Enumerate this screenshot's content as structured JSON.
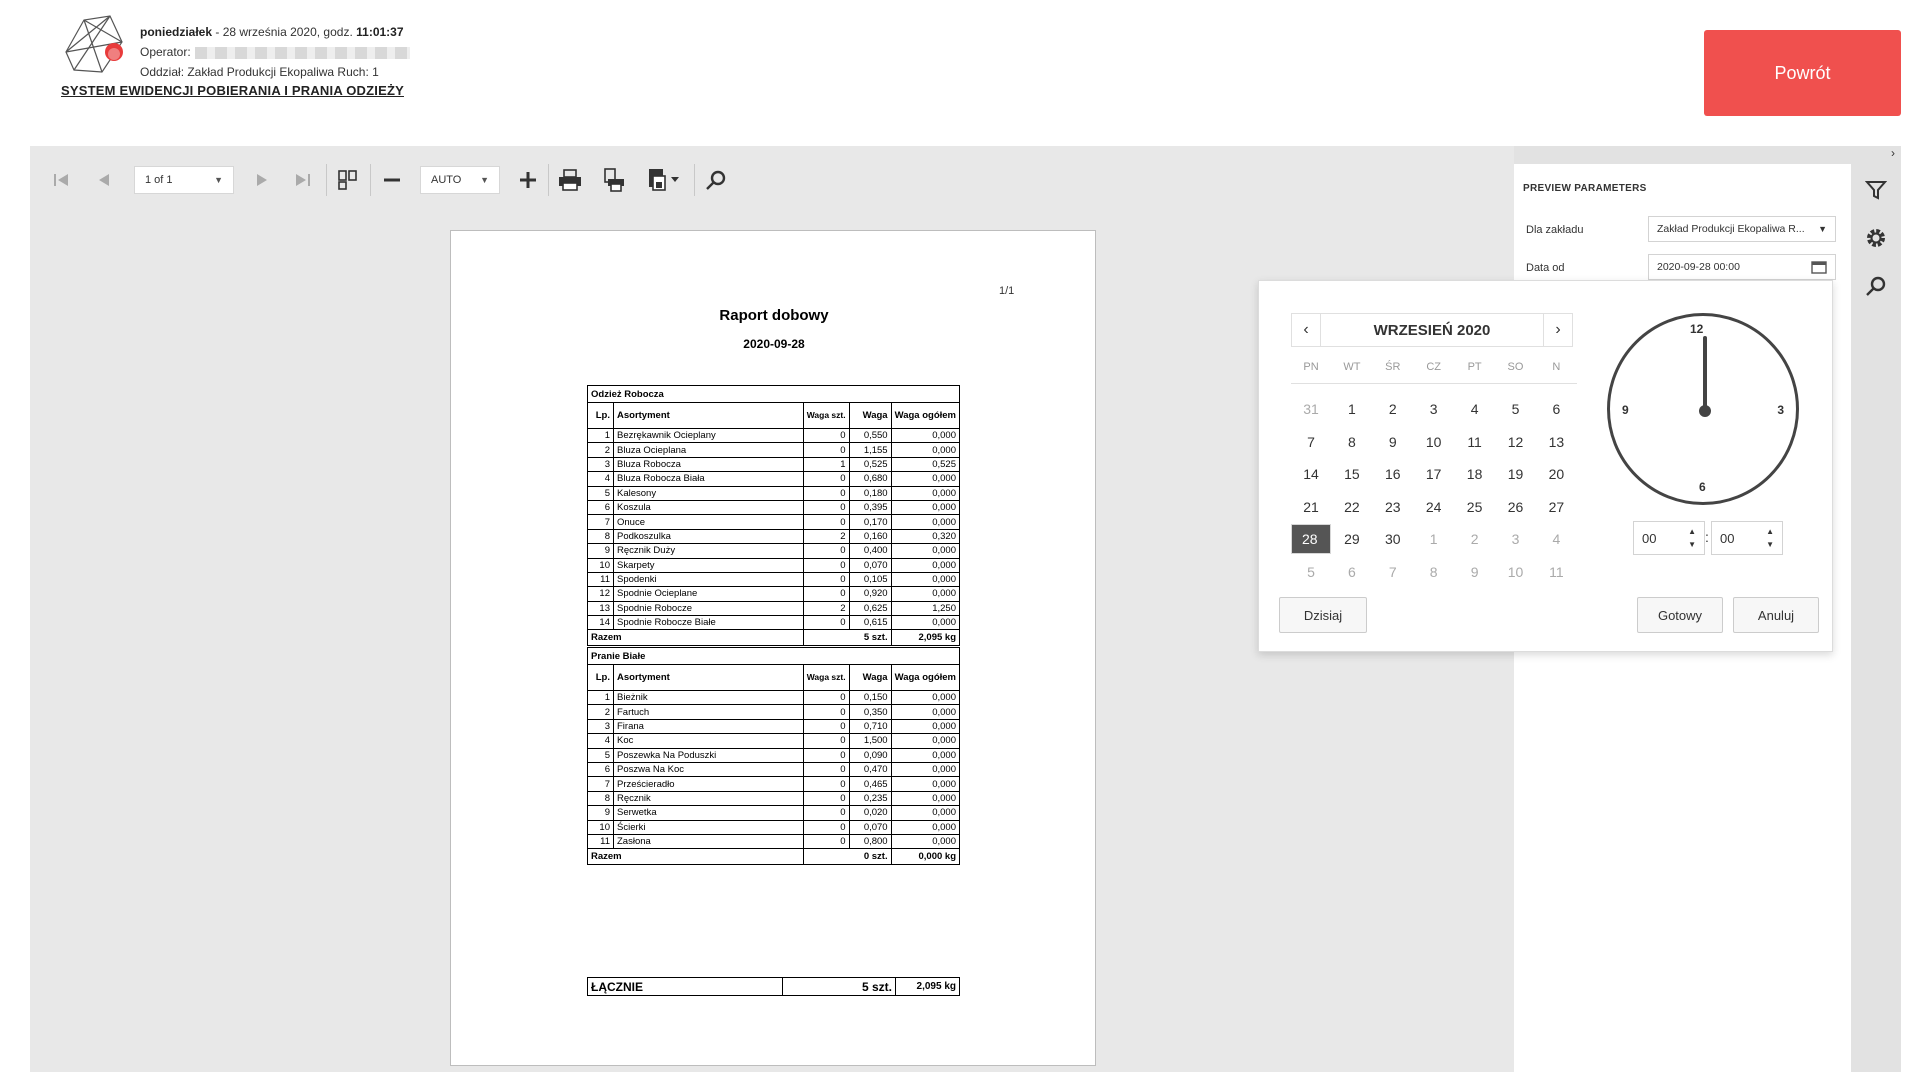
{
  "header": {
    "day": "poniedziałek",
    "date_text": "- 28 września 2020, godz.",
    "time": "11:01:37",
    "operator_label": "Operator:",
    "department": "Oddział: Zakład Produkcji Ekopaliwa Ruch: 1",
    "system_title": "SYSTEM EWIDENCJI POBIERANIA I PRANIA ODZIEŻY",
    "back_label": "Powrót",
    "back_color": "#f0504e"
  },
  "toolbar": {
    "page_select": "1 of 1",
    "zoom_select": "AUTO"
  },
  "report": {
    "page_number": "1/1",
    "title": "Raport dobowy",
    "date": "2020-09-28",
    "columns": {
      "lp": "Lp.",
      "name": "Asortyment",
      "qty": "Waga szt.",
      "weight": "Waga",
      "total": "Waga ogółem"
    },
    "sections": [
      {
        "name": "Odzież Robocza",
        "rows": [
          {
            "lp": "1",
            "name": "Bezrękawnik Ocieplany",
            "qty": "0",
            "weight": "0,550",
            "total": "0,000"
          },
          {
            "lp": "2",
            "name": "Bluza Ocieplana",
            "qty": "0",
            "weight": "1,155",
            "total": "0,000"
          },
          {
            "lp": "3",
            "name": "Bluza Robocza",
            "qty": "1",
            "weight": "0,525",
            "total": "0,525"
          },
          {
            "lp": "4",
            "name": "Bluza Robocza Biała",
            "qty": "0",
            "weight": "0,680",
            "total": "0,000"
          },
          {
            "lp": "5",
            "name": "Kalesony",
            "qty": "0",
            "weight": "0,180",
            "total": "0,000"
          },
          {
            "lp": "6",
            "name": "Koszula",
            "qty": "0",
            "weight": "0,395",
            "total": "0,000"
          },
          {
            "lp": "7",
            "name": "Onuce",
            "qty": "0",
            "weight": "0,170",
            "total": "0,000"
          },
          {
            "lp": "8",
            "name": "Podkoszulka",
            "qty": "2",
            "weight": "0,160",
            "total": "0,320"
          },
          {
            "lp": "9",
            "name": "Ręcznik Duży",
            "qty": "0",
            "weight": "0,400",
            "total": "0,000"
          },
          {
            "lp": "10",
            "name": "Skarpety",
            "qty": "0",
            "weight": "0,070",
            "total": "0,000"
          },
          {
            "lp": "11",
            "name": "Spodenki",
            "qty": "0",
            "weight": "0,105",
            "total": "0,000"
          },
          {
            "lp": "12",
            "name": "Spodnie Ocieplane",
            "qty": "0",
            "weight": "0,920",
            "total": "0,000"
          },
          {
            "lp": "13",
            "name": "Spodnie Robocze",
            "qty": "2",
            "weight": "0,625",
            "total": "1,250"
          },
          {
            "lp": "14",
            "name": "Spodnie Robocze Białe",
            "qty": "0",
            "weight": "0,615",
            "total": "0,000"
          }
        ],
        "sum_label": "Razem",
        "sum_qty": "5 szt.",
        "sum_total": "2,095 kg"
      },
      {
        "name": "Pranie Białe",
        "rows": [
          {
            "lp": "1",
            "name": "Bieżnik",
            "qty": "0",
            "weight": "0,150",
            "total": "0,000"
          },
          {
            "lp": "2",
            "name": "Fartuch",
            "qty": "0",
            "weight": "0,350",
            "total": "0,000"
          },
          {
            "lp": "3",
            "name": "Firana",
            "qty": "0",
            "weight": "0,710",
            "total": "0,000"
          },
          {
            "lp": "4",
            "name": "Koc",
            "qty": "0",
            "weight": "1,500",
            "total": "0,000"
          },
          {
            "lp": "5",
            "name": "Poszewka Na Poduszki",
            "qty": "0",
            "weight": "0,090",
            "total": "0,000"
          },
          {
            "lp": "6",
            "name": "Poszwa Na Koc",
            "qty": "0",
            "weight": "0,470",
            "total": "0,000"
          },
          {
            "lp": "7",
            "name": "Prześcieradło",
            "qty": "0",
            "weight": "0,465",
            "total": "0,000"
          },
          {
            "lp": "8",
            "name": "Ręcznik",
            "qty": "0",
            "weight": "0,235",
            "total": "0,000"
          },
          {
            "lp": "9",
            "name": "Serwetka",
            "qty": "0",
            "weight": "0,020",
            "total": "0,000"
          },
          {
            "lp": "10",
            "name": "Ścierki",
            "qty": "0",
            "weight": "0,070",
            "total": "0,000"
          },
          {
            "lp": "11",
            "name": "Zasłona",
            "qty": "0",
            "weight": "0,800",
            "total": "0,000"
          }
        ],
        "sum_label": "Razem",
        "sum_qty": "0 szt.",
        "sum_total": "0,000 kg"
      }
    ],
    "grand": {
      "label": "ŁĄCZNIE",
      "qty": "5 szt.",
      "total": "2,095 kg"
    }
  },
  "params": {
    "title": "PREVIEW PARAMETERS",
    "plant_label": "Dla zakładu",
    "plant_value": "Zakład Produkcji Ekopaliwa R...",
    "date_from_label": "Data od",
    "date_from_value": "2020-09-28 00:00"
  },
  "datepicker": {
    "month_title": "WRZESIEŃ 2020",
    "weekdays": [
      "PN",
      "WT",
      "ŚR",
      "CZ",
      "PT",
      "SO",
      "N"
    ],
    "weeks": [
      [
        "31",
        "1",
        "2",
        "3",
        "4",
        "5",
        "6"
      ],
      [
        "7",
        "8",
        "9",
        "10",
        "11",
        "12",
        "13"
      ],
      [
        "14",
        "15",
        "16",
        "17",
        "18",
        "19",
        "20"
      ],
      [
        "21",
        "22",
        "23",
        "24",
        "25",
        "26",
        "27"
      ],
      [
        "28",
        "29",
        "30",
        "1",
        "2",
        "3",
        "4"
      ],
      [
        "5",
        "6",
        "7",
        "8",
        "9",
        "10",
        "11"
      ]
    ],
    "selected_day": "28",
    "clock_labels": {
      "top": "12",
      "right": "3",
      "bottom": "6",
      "left": "9"
    },
    "hour": "00",
    "minute": "00",
    "today_label": "Dzisiaj",
    "done_label": "Gotowy",
    "cancel_label": "Anuluj"
  }
}
